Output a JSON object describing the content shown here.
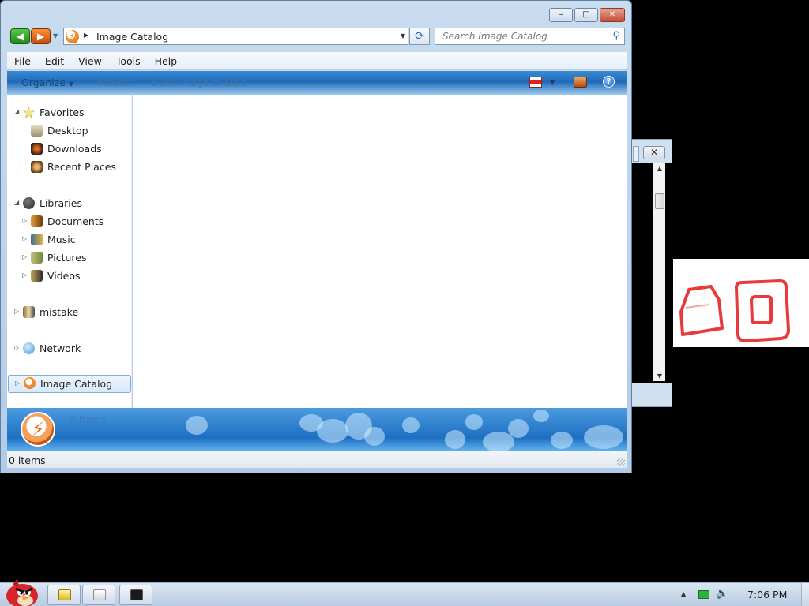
{
  "window": {
    "caption_buttons": {
      "minimize": "–",
      "maximize": "□",
      "close": "✕"
    },
    "address": {
      "location": "Image Catalog"
    },
    "search": {
      "placeholder": "Search Image Catalog"
    },
    "menu": [
      "File",
      "Edit",
      "View",
      "Tools",
      "Help"
    ],
    "toolbar": {
      "organize": "Organize",
      "mount": "Mount",
      "burn": "Burn Image to Disc",
      "help": "?"
    },
    "nav": {
      "favorites": {
        "label": "Favorites",
        "items": [
          "Desktop",
          "Downloads",
          "Recent Places"
        ]
      },
      "libraries": {
        "label": "Libraries",
        "items": [
          "Documents",
          "Music",
          "Pictures",
          "Videos"
        ]
      },
      "homegroup": "mistake",
      "network": "Network",
      "image_catalog": "Image Catalog"
    },
    "details": {
      "count": "0 items"
    },
    "status": {
      "count": "0 items"
    }
  },
  "taskbar": {
    "clock": "7:06 PM"
  },
  "colors": {
    "toolbar": "#1f6ab9",
    "close_button": "#c14d34",
    "selection": "#d6e9f9"
  },
  "icons": [
    "back-icon",
    "forward-icon",
    "refresh-icon",
    "search-icon",
    "help-icon",
    "star-icon",
    "library-icon",
    "network-icon",
    "volume-icon"
  ]
}
